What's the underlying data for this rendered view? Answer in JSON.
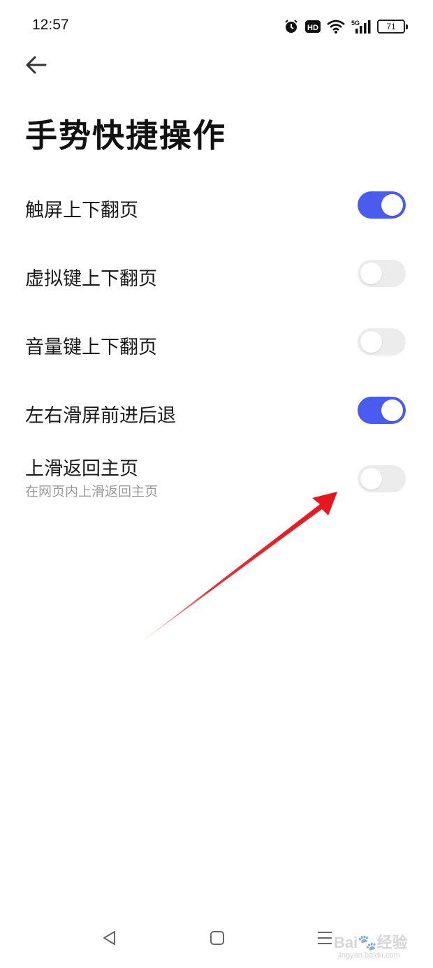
{
  "status_bar": {
    "time": "12:57",
    "network": "5G",
    "hd_badge": "HD",
    "battery": "71",
    "icons": [
      "alarm-icon",
      "hd-icon",
      "wifi-icon",
      "signal-icon",
      "battery-icon"
    ]
  },
  "header": {
    "back_icon": "arrow-left-icon",
    "title": "手势快捷操作"
  },
  "settings": [
    {
      "label": "触屏上下翻页",
      "enabled": true
    },
    {
      "label": "虚拟键上下翻页",
      "enabled": false
    },
    {
      "label": "音量键上下翻页",
      "enabled": false
    },
    {
      "label": "左右滑屏前进后退",
      "enabled": true
    },
    {
      "label": "上滑返回主页",
      "sublabel": "在网页内上滑返回主页",
      "enabled": false
    }
  ],
  "nav_bar": {
    "icons": [
      "back-triangle-icon",
      "home-square-icon",
      "menu-icon"
    ]
  },
  "watermark": {
    "brand": "Bai",
    "brand_cn": "经验",
    "url": "jingyan.baidu.com"
  },
  "colors": {
    "toggle_on": "#4a5cf0",
    "toggle_off": "#ececec",
    "annotation_arrow": "#e8141b"
  }
}
